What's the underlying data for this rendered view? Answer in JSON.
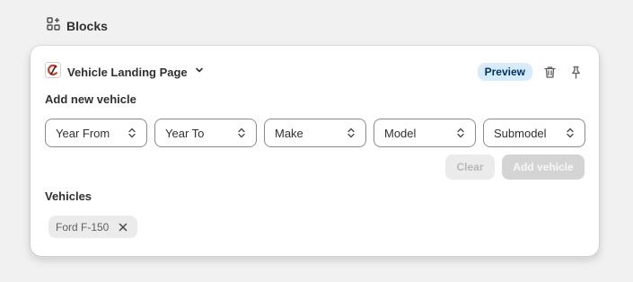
{
  "header": {
    "title": "Blocks",
    "icon": "blocks-icon"
  },
  "block": {
    "title": "Vehicle Landing Page",
    "badge": "Preview",
    "accent_color": "#d93b1f",
    "badge_bg": "#d7ebff"
  },
  "add_section": {
    "label": "Add new vehicle"
  },
  "selects": [
    {
      "label": "Year From"
    },
    {
      "label": "Year To"
    },
    {
      "label": "Make"
    },
    {
      "label": "Model"
    },
    {
      "label": "Submodel"
    }
  ],
  "actions": {
    "clear_label": "Clear",
    "add_label": "Add vehicle"
  },
  "vehicles_section": {
    "label": "Vehicles",
    "items": [
      {
        "label": "Ford F-150"
      }
    ]
  }
}
